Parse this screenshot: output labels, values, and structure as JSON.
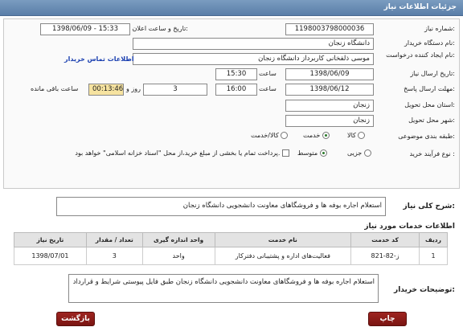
{
  "header": {
    "title": "جزئیات اطلاعات نیاز"
  },
  "form": {
    "need_number": {
      "label": "شماره نیاز:",
      "value": "1198003798000036"
    },
    "announce_datetime": {
      "label": "تاریخ و ساعت اعلان عمومی:",
      "value": "1398/06/09 - 15:33"
    },
    "buyer_org": {
      "label": "نام دستگاه خریدار:",
      "value": "دانشگاه زنجان"
    },
    "requester": {
      "label": "نام ایجاد کننده درخواست:",
      "value": "موسی  ذلفخانی کاربرداز دانشگاه زنجان",
      "contact_link": "اطلاعات تماس خریدار"
    },
    "send_date": {
      "label": "تاریخ ارسال نیاز:",
      "date": "1398/06/09",
      "time_label": "ساعت",
      "time": "15:30"
    },
    "deadline": {
      "label": "مهلت ارسال پاسخ:",
      "date": "1398/06/12",
      "time_label": "ساعت",
      "time": "16:00",
      "days": "3",
      "days_label": "روز و",
      "remaining": "00:13:46",
      "remaining_label": "ساعت باقی مانده"
    },
    "province": {
      "label": "استان محل تحویل:",
      "value": "زنجان"
    },
    "city": {
      "label": "شهر محل تحویل:",
      "value": "زنجان"
    },
    "category": {
      "label": "طبقه بندی موضوعی:",
      "options": [
        "کالا",
        "خدمت",
        "کالا/خدمت"
      ],
      "selected": "خدمت"
    },
    "purchase_type": {
      "label": "نوع فرآیند خرید :",
      "options": [
        "جزیی",
        "متوسط"
      ],
      "selected": "متوسط",
      "note": "پرداخت تمام یا بخشی از مبلغ خرید،از محل \"اسناد خزانه اسلامی\" خواهد بود."
    }
  },
  "summary": {
    "label": "شرح کلی نیاز:",
    "value": "استعلام اجاره بوفه ها و فروشگاهای معاونت دانشجویی دانشگاه زنجان"
  },
  "services": {
    "heading": "اطلاعات خدمات مورد نیاز",
    "columns": [
      "ردیف",
      "کد خدمت",
      "نام خدمت",
      "واحد اندازه گیری",
      "تعداد / مقدار",
      "تاریخ نیاز"
    ],
    "rows": [
      [
        "1",
        "ز-82-821",
        "فعالیت‌های اداره و پشتیبانی دفترکار",
        "واحد",
        "3",
        "1398/07/01"
      ]
    ]
  },
  "buyer_notes": {
    "label": "توضیحات خریدار:",
    "value": "استعلام اجاره بوفه ها و فروشگاهای معاونت دانشجویی دانشگاه زنجان طبق فایل پیوستی شرایط و قرارداد"
  },
  "buttons": {
    "print": "چاپ",
    "back": "بازگشت"
  }
}
